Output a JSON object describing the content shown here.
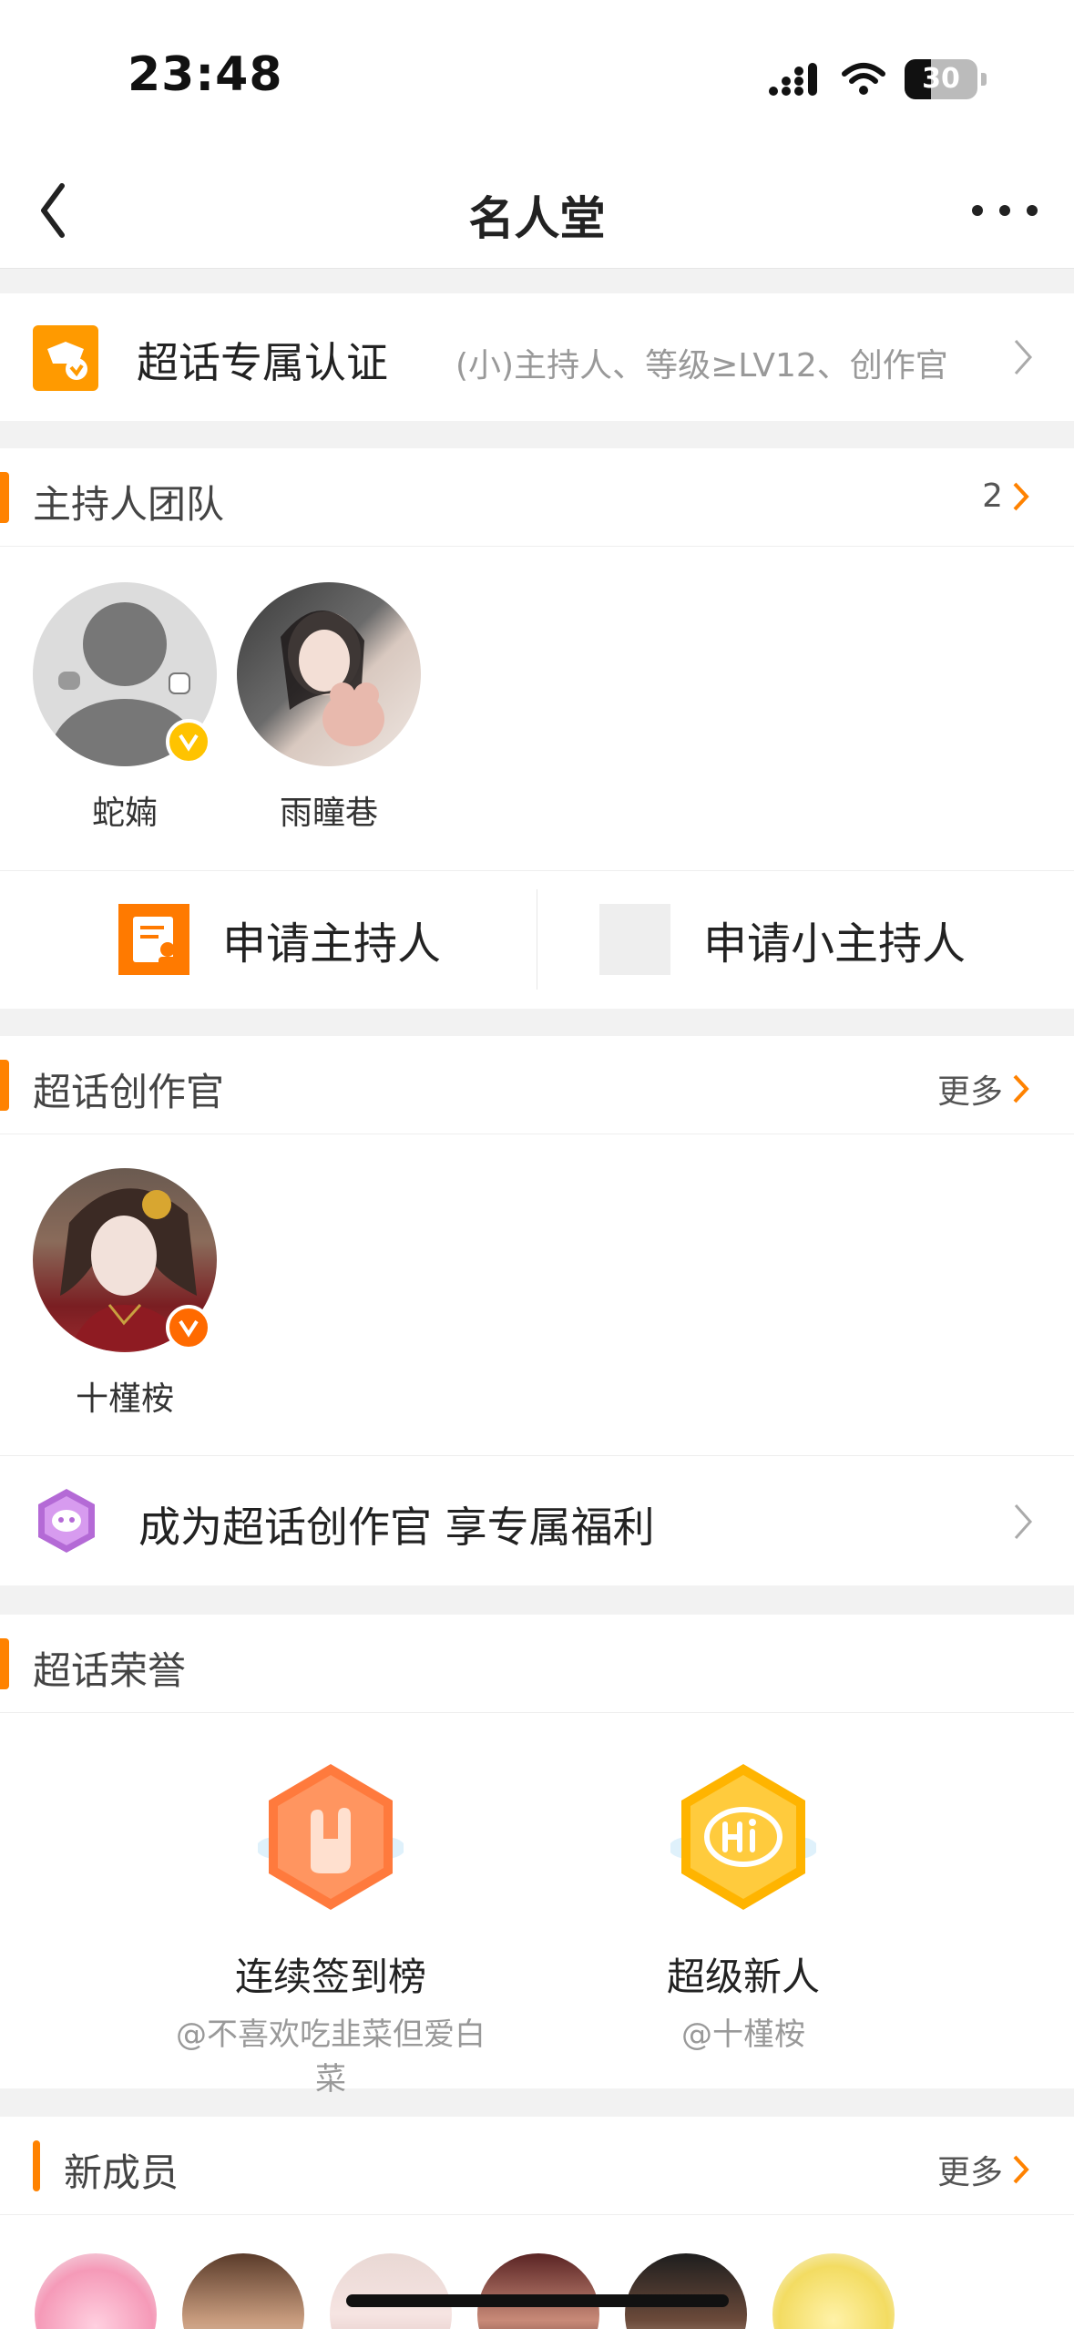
{
  "status_bar": {
    "time": "23:48",
    "battery": "30"
  },
  "nav": {
    "title": "名人堂"
  },
  "certification": {
    "title": "超话专属认证",
    "subtitle": "(小)主持人、等级≥LV12、创作官"
  },
  "host_team": {
    "title": "主持人团队",
    "count": "2",
    "members": [
      {
        "name": "蛇婻"
      },
      {
        "name": "雨瞳巷"
      }
    ],
    "apply_host": "申请主持人",
    "apply_small_host": "申请小主持人"
  },
  "creators": {
    "title": "超话创作官",
    "more": "更多",
    "members": [
      {
        "name": "十槿桉"
      }
    ],
    "promo": "成为超话创作官 享专属福利"
  },
  "honors": {
    "title": "超话荣誉",
    "items": [
      {
        "title": "连续签到榜",
        "user": "@不喜欢吃韭菜但爱白菜",
        "icon": "rock-hand-badge-icon"
      },
      {
        "title": "超级新人",
        "user": "@十槿桉",
        "icon": "hi-badge-icon"
      }
    ]
  },
  "new_members": {
    "title": "新成员",
    "more": "更多"
  },
  "colors": {
    "accent": "#ff8200",
    "vip_badge": "#ffc300",
    "creator_badge": "#ff6a00"
  }
}
